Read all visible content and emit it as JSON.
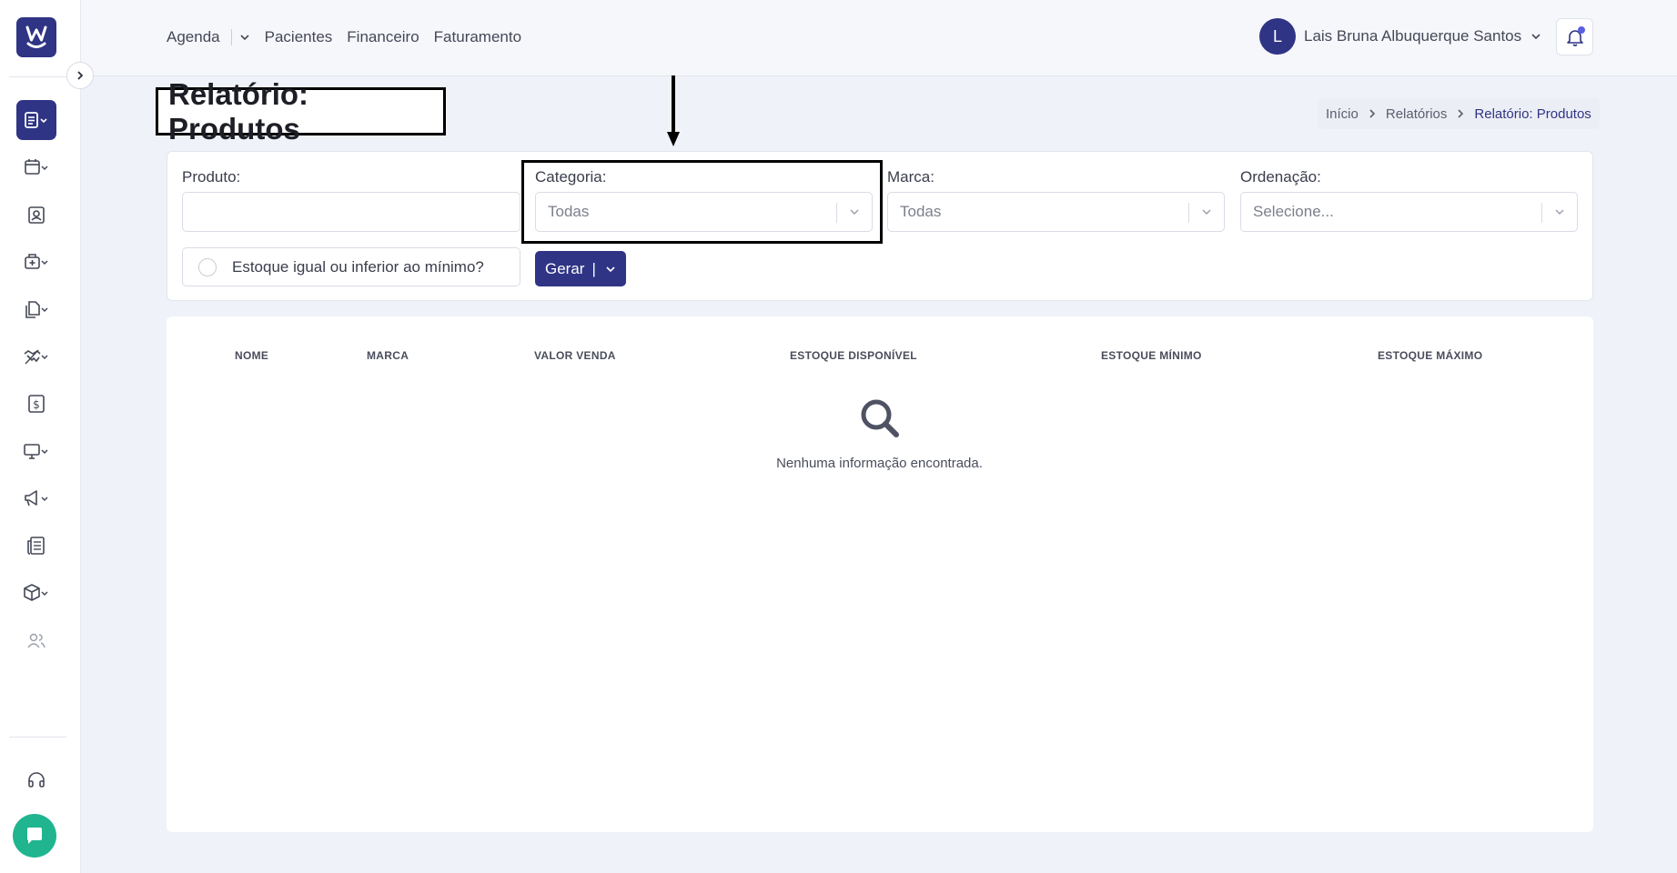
{
  "topnav": {
    "items": [
      "Agenda",
      "Pacientes",
      "Financeiro",
      "Faturamento"
    ]
  },
  "user": {
    "initial": "L",
    "name": "Lais Bruna Albuquerque Santos"
  },
  "page": {
    "title": "Relatório: Produtos"
  },
  "breadcrumb": [
    "Início",
    "Relatórios",
    "Relatório: Produtos"
  ],
  "filters": {
    "produto_label": "Produto:",
    "produto_value": "",
    "categoria_label": "Categoria:",
    "categoria_value": "Todas",
    "marca_label": "Marca:",
    "marca_value": "Todas",
    "ordenacao_label": "Ordenação:",
    "ordenacao_placeholder": "Selecione...",
    "estoque_checkbox_label": "Estoque igual ou inferior ao mínimo?",
    "gerar_label": "Gerar",
    "gerar_sep": "|"
  },
  "table": {
    "columns": [
      "NOME",
      "MARCA",
      "VALOR VENDA",
      "ESTOQUE DISPONÍVEL",
      "ESTOQUE MÍNIMO",
      "ESTOQUE MÁXIMO"
    ],
    "empty_message": "Nenhuma informação encontrada."
  },
  "colors": {
    "brand": "#2f3485",
    "chat": "#20b58f",
    "notification_dot": "#5a5fe0"
  },
  "icons": {
    "sidebar": [
      "reports-icon",
      "calendar-icon",
      "patient-card-icon",
      "medical-bag-icon",
      "documents-icon",
      "handshake-icon",
      "dollar-icon",
      "monitor-icon",
      "megaphone-icon",
      "newspaper-icon",
      "package-icon",
      "users-icon",
      "headset-icon"
    ]
  }
}
